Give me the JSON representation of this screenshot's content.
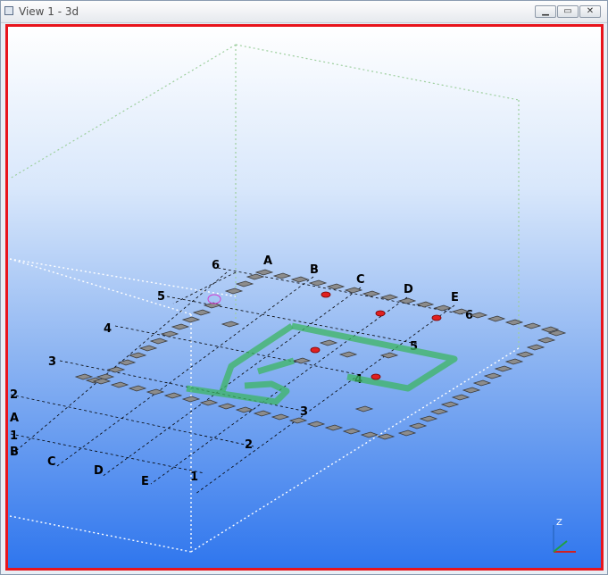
{
  "window": {
    "title": "View 1 - 3d"
  },
  "controls": {
    "minimize": "▁",
    "restore": "▭",
    "close": "✕"
  },
  "grid": {
    "top_letters": [
      "A",
      "B",
      "C",
      "D",
      "E"
    ],
    "left_letters": [
      "A",
      "B",
      "C",
      "D",
      "E"
    ],
    "left_numbers": [
      "6",
      "5",
      "4",
      "3",
      "2",
      "1"
    ],
    "right_numbers": [
      "6",
      "5",
      "4",
      "3",
      "2",
      "1"
    ]
  },
  "axes": {
    "z_label": "Z"
  },
  "colors": {
    "frame_border": "#e8141c",
    "beam": "#55cc77",
    "column_marker": "#e02020"
  }
}
